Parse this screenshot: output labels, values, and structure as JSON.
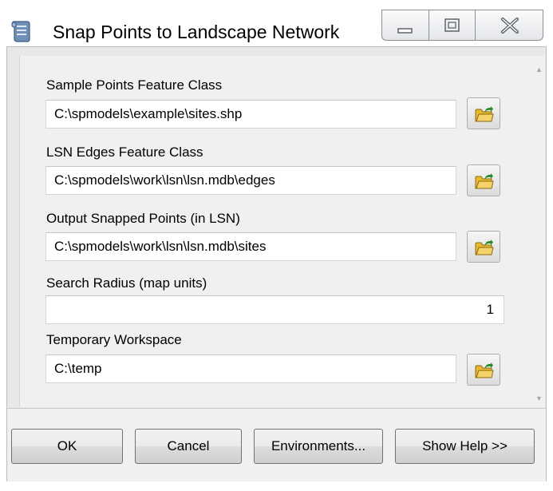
{
  "window": {
    "title": "Snap Points to Landscape Network",
    "icon": "script-scroll-icon"
  },
  "fields": [
    {
      "label": "Sample Points Feature Class",
      "value": "C:\\spmodels\\example\\sites.shp",
      "browse": true
    },
    {
      "label": "LSN Edges Feature Class",
      "value": "C:\\spmodels\\work\\lsn\\lsn.mdb\\edges",
      "browse": true
    },
    {
      "label": "Output Snapped Points (in LSN)",
      "value": "C:\\spmodels\\work\\lsn\\lsn.mdb\\sites",
      "browse": true
    },
    {
      "label": "Search Radius (map units)",
      "value": "1",
      "browse": false
    },
    {
      "label": "Temporary Workspace",
      "value": "C:\\temp",
      "browse": true
    }
  ],
  "buttons": {
    "ok": "OK",
    "cancel": "Cancel",
    "environments": "Environments...",
    "show_help": "Show Help >>"
  },
  "colors": {
    "folder": "#e8b830",
    "folder_arrow": "#2a8a2a"
  }
}
